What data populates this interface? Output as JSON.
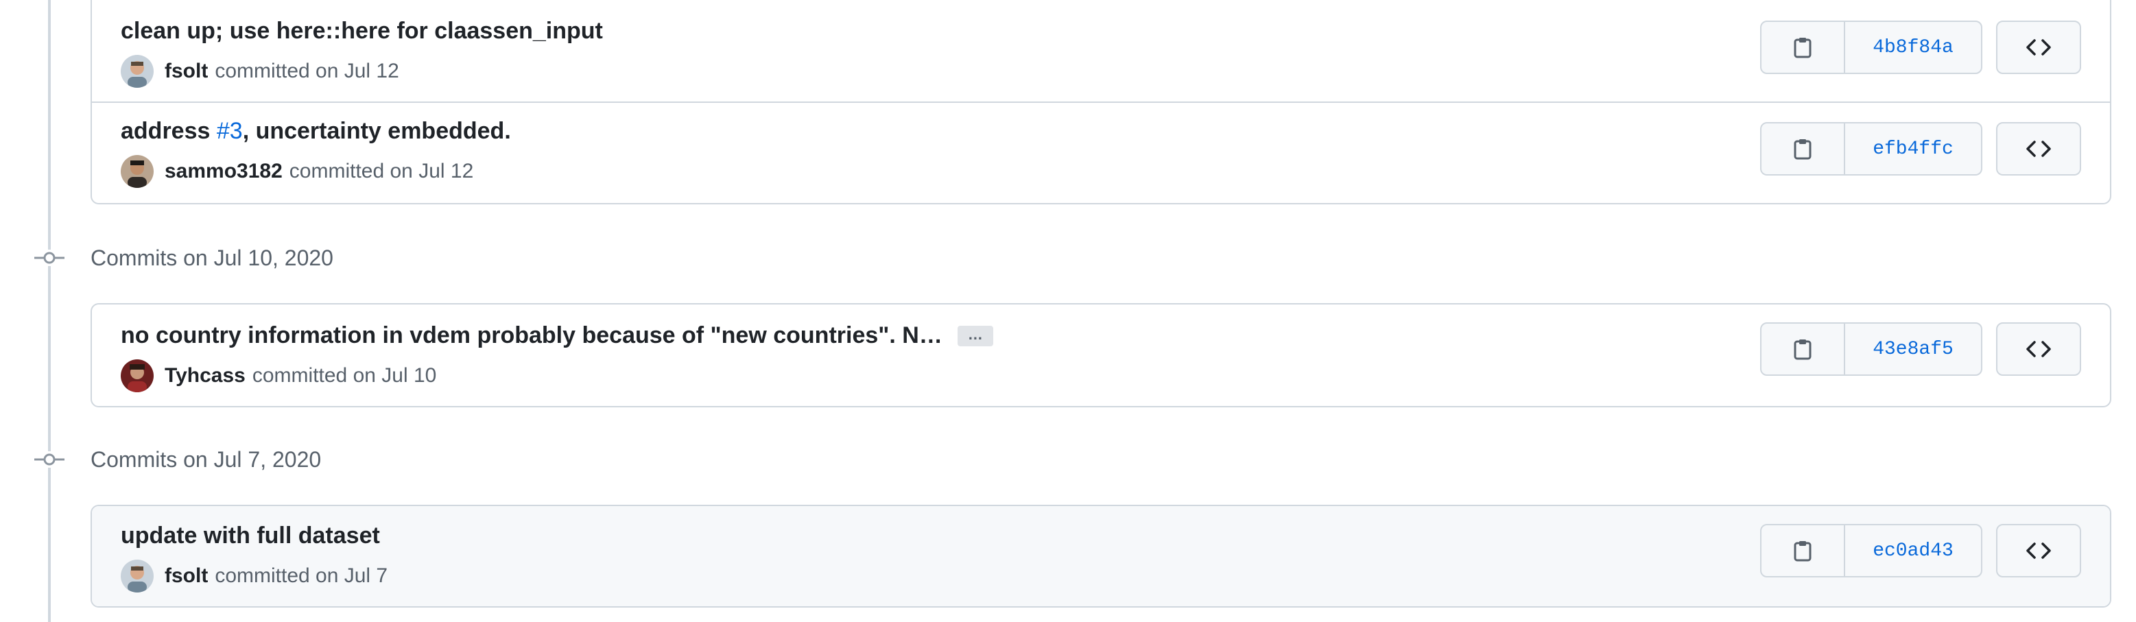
{
  "day_groups": [
    {
      "title": "",
      "commits": [
        {
          "message": "clean up; use here::here for claassen_input",
          "author": "fsolt",
          "meta": "committed on Jul 12",
          "sha": "4b8f84a",
          "avatar_color": "#8a9aa8"
        },
        {
          "message_prefix": "address ",
          "issue": "#3",
          "message_suffix": ", uncertainty embedded.",
          "author": "sammo3182",
          "meta": "committed on Jul 12",
          "sha": "efb4ffc",
          "avatar_color": "#5a4636"
        }
      ]
    },
    {
      "title": "Commits on Jul 10, 2020",
      "commits": [
        {
          "message": "no country information in vdem probably because of \"new countries\". N…",
          "ellipsis": "…",
          "author": "Tyhcass",
          "meta": "committed on Jul 10",
          "sha": "43e8af5",
          "avatar_color": "#7a2b2b"
        }
      ]
    },
    {
      "title": "Commits on Jul 7, 2020",
      "commits": [
        {
          "message": "update with full dataset",
          "author": "fsolt",
          "meta": "committed on Jul 7",
          "sha": "ec0ad43",
          "avatar_color": "#8a9aa8"
        }
      ]
    }
  ],
  "icons": {
    "copy": "clipboard-icon",
    "browse": "code-icon",
    "node": "git-commit-icon"
  },
  "colors": {
    "link": "#0969da",
    "border": "#d0d7de",
    "muted": "#57606a"
  }
}
